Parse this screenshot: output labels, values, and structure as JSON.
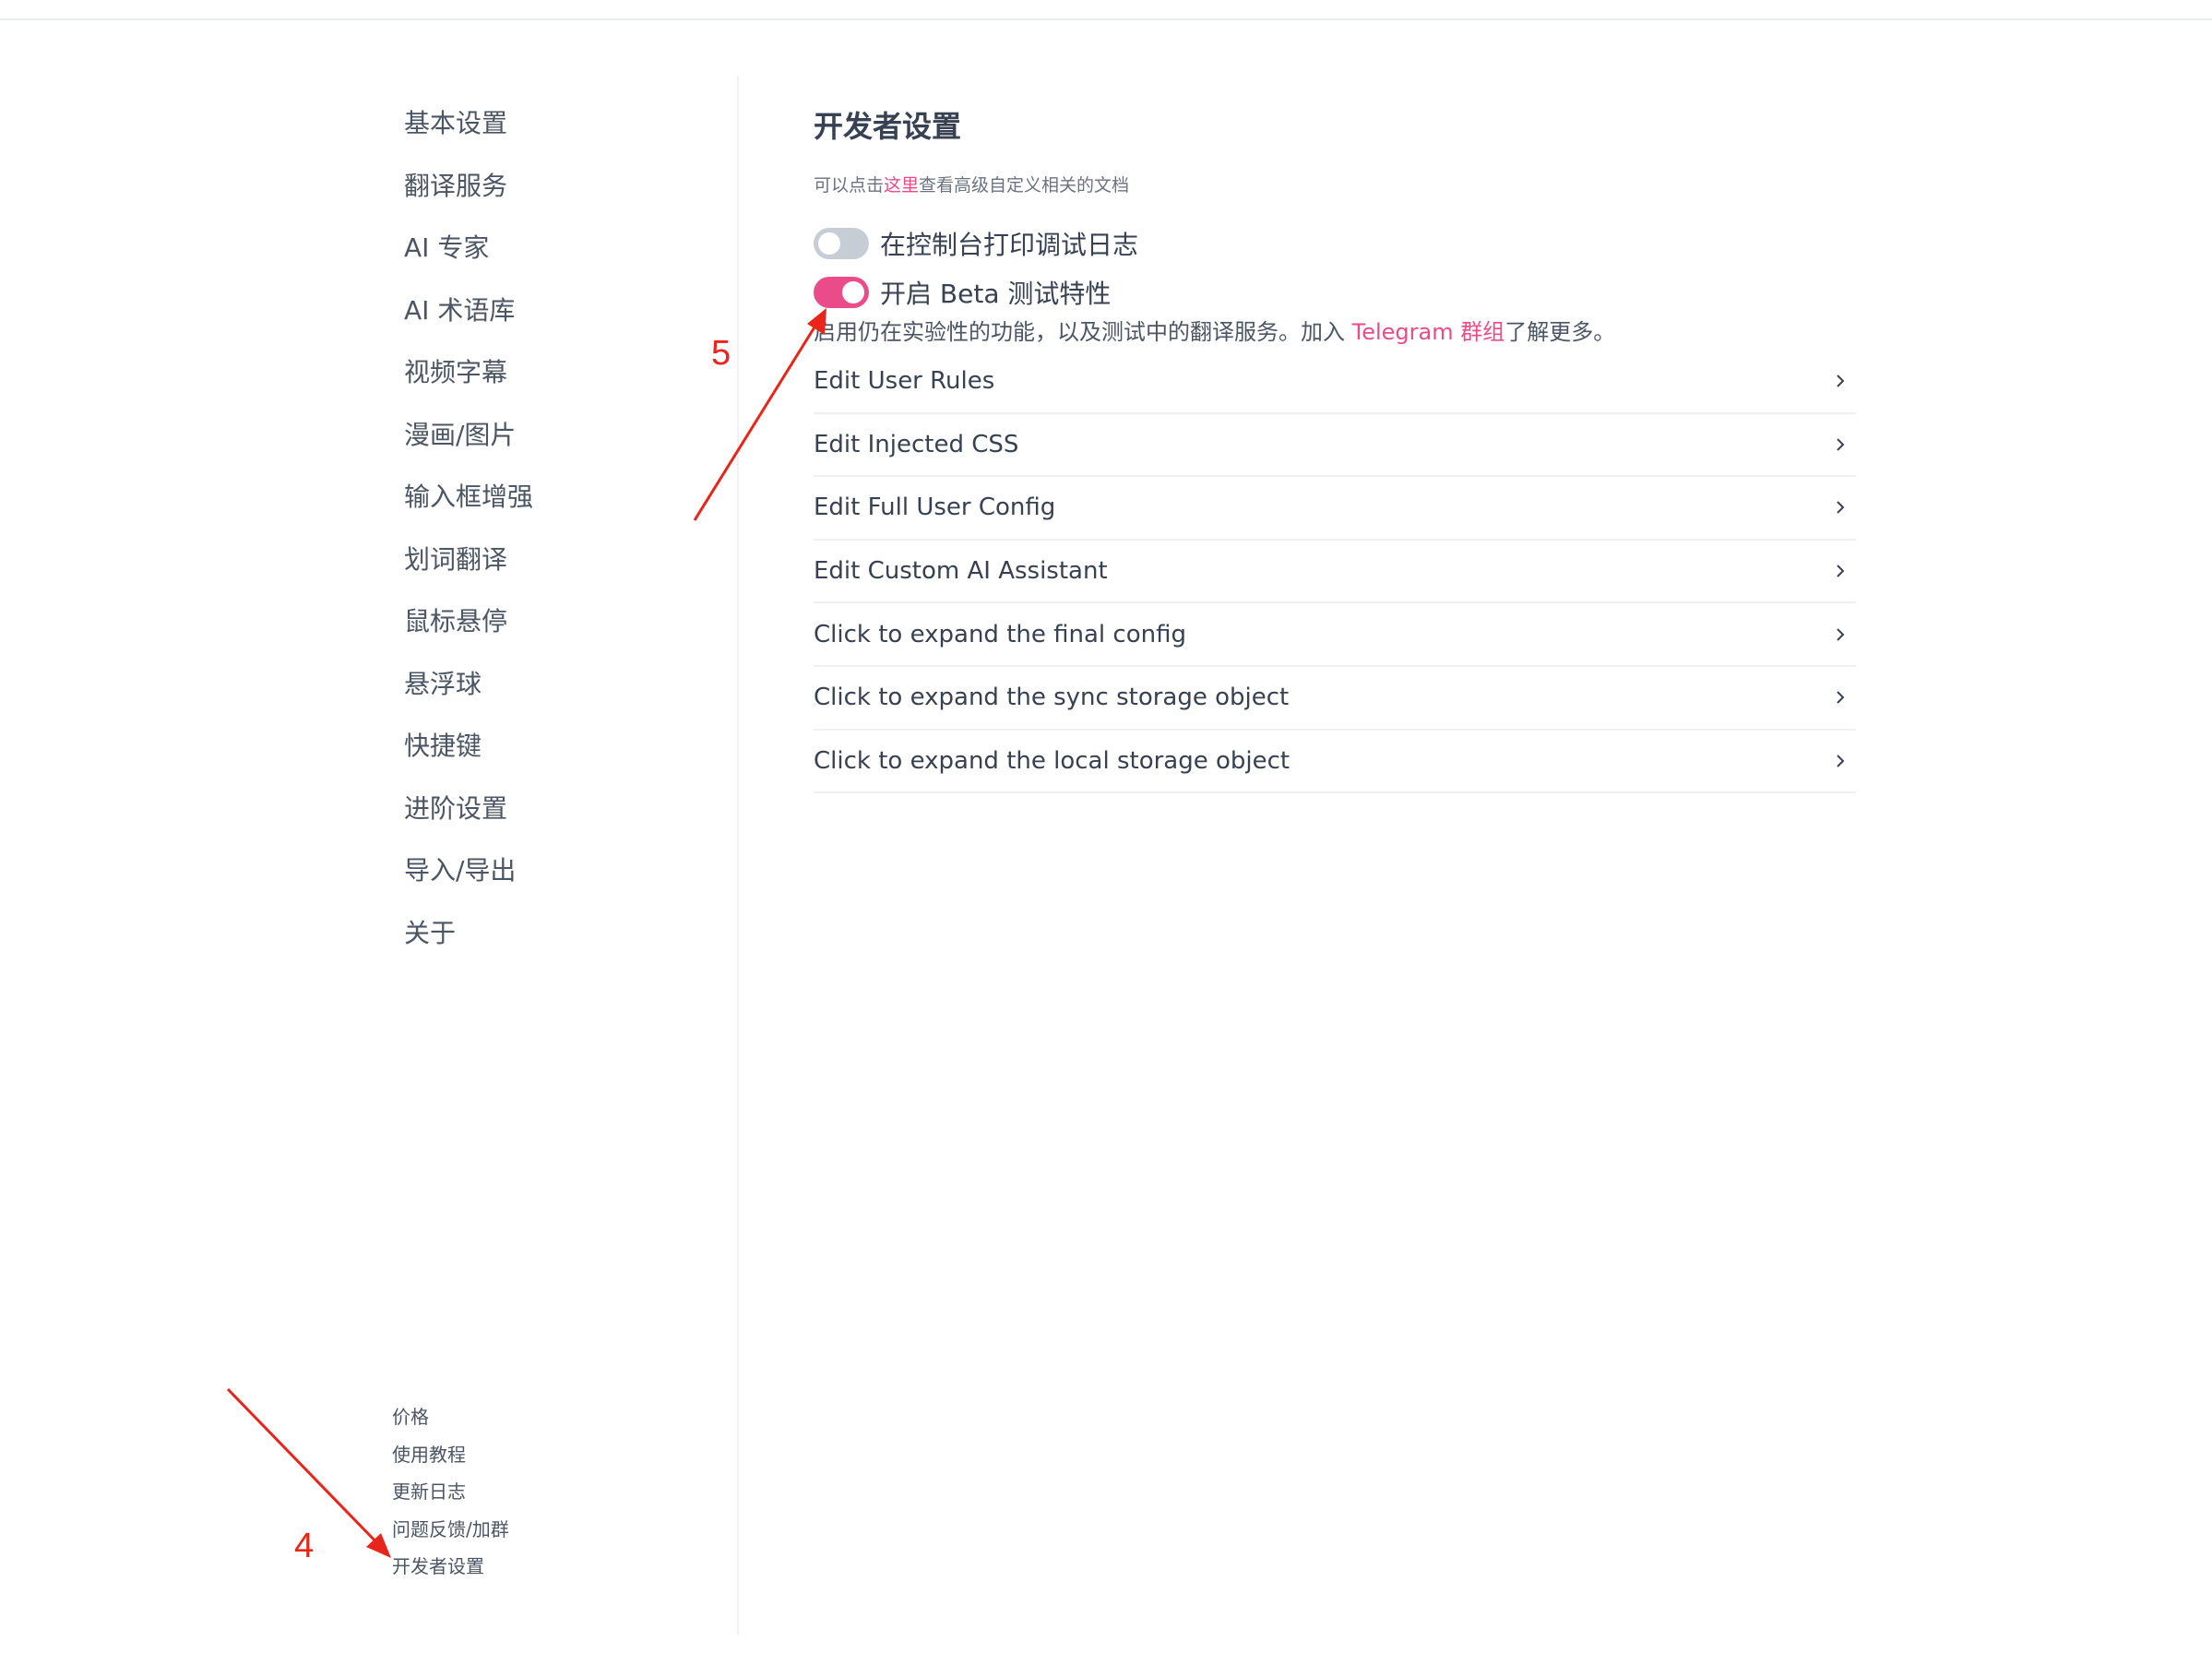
{
  "sidebar": {
    "items": [
      {
        "label": "基本设置"
      },
      {
        "label": "翻译服务"
      },
      {
        "label": "AI 专家"
      },
      {
        "label": "AI 术语库"
      },
      {
        "label": "视频字幕"
      },
      {
        "label": "漫画/图片"
      },
      {
        "label": "输入框增强"
      },
      {
        "label": "划词翻译"
      },
      {
        "label": "鼠标悬停"
      },
      {
        "label": "悬浮球"
      },
      {
        "label": "快捷键"
      },
      {
        "label": "进阶设置"
      },
      {
        "label": "导入/导出"
      },
      {
        "label": "关于"
      }
    ],
    "footer_links": [
      {
        "label": "价格"
      },
      {
        "label": "使用教程"
      },
      {
        "label": "更新日志"
      },
      {
        "label": "问题反馈/加群"
      },
      {
        "label": "开发者设置"
      }
    ]
  },
  "main": {
    "title": "开发者设置",
    "doc_hint": {
      "prefix": "可以点击",
      "link": "这里",
      "suffix": "查看高级自定义相关的文档"
    },
    "toggles": [
      {
        "label": "在控制台打印调试日志",
        "on": false
      },
      {
        "label": "开启 Beta 测试特性",
        "on": true
      }
    ],
    "beta_desc": {
      "prefix": "启用仍在实验性的功能，以及测试中的翻译服务。加入 ",
      "link": "Telegram 群组",
      "suffix": "了解更多。"
    },
    "rows": [
      {
        "label": "Edit User Rules",
        "icon": "chevron-right-icon"
      },
      {
        "label": "Edit Injected CSS",
        "icon": "chevron-right-icon"
      },
      {
        "label": "Edit Full User Config",
        "icon": "chevron-right-icon"
      },
      {
        "label": "Edit Custom AI Assistant",
        "icon": "chevron-right-icon"
      },
      {
        "label": "Click to expand the final config",
        "icon": "chevron-right-icon"
      },
      {
        "label": "Click to expand the sync storage object",
        "icon": "chevron-right-icon"
      },
      {
        "label": "Click to expand the local storage object",
        "icon": "chevron-right-icon"
      }
    ]
  },
  "annotations": {
    "step4": "4",
    "step5": "5"
  },
  "colors": {
    "accent": "#ea4c89",
    "annotation": "#e8251b",
    "toggle_off": "#c7cdd4"
  }
}
